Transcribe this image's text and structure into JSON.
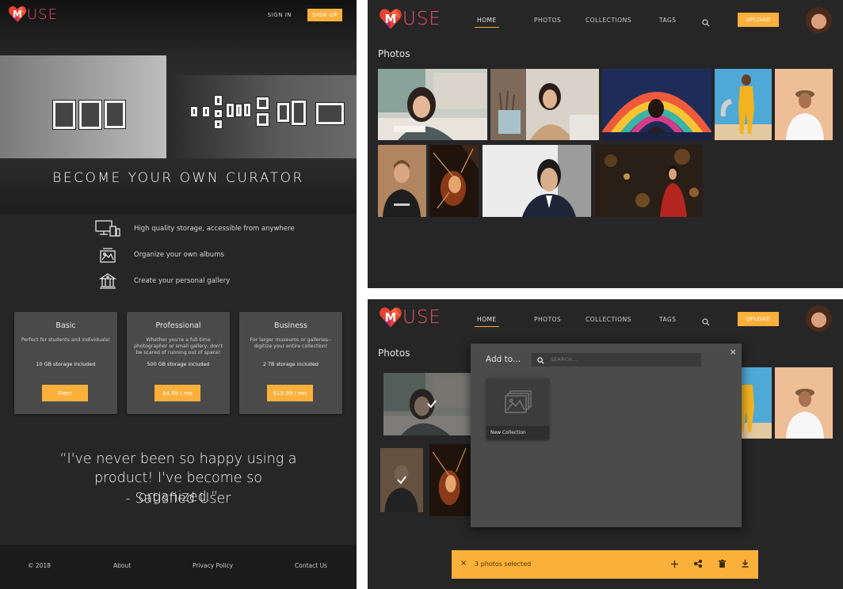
{
  "brand": {
    "logo_letter": "M",
    "logo_rest": "USE"
  },
  "landing": {
    "nav": {
      "sign_in": "SIGN IN",
      "sign_up": "SIGN UP"
    },
    "hero_title": "BECOME YOUR OWN CURATOR",
    "features": [
      {
        "icon": "devices-icon",
        "text": "High quality storage, accessible from anywhere"
      },
      {
        "icon": "album-icon",
        "text": "Organize your own albums"
      },
      {
        "icon": "gallery-building-icon",
        "text": "Create your personal gallery"
      }
    ],
    "plans": [
      {
        "name": "Basic",
        "description": "Perfect for students and individuals!",
        "storage": "10 GB storage included",
        "cta": "Free!"
      },
      {
        "name": "Professional",
        "description": "Whether you're a full-time photographer or small gallery, don't be scared of running out of space!",
        "storage": "500 GB storage included",
        "cta": "$4.99 / mo"
      },
      {
        "name": "Business",
        "description": "For larger museums or galleries--digitize your entire collection!",
        "storage": "2 TB storage included",
        "cta": "$15.99 / mo"
      }
    ],
    "quote": "“I've never been so happy using a product! I've become so organized.”",
    "quote_author": "- Satisfied User",
    "footer": {
      "copyright": "© 2018",
      "about": "About",
      "privacy": "Privacy Policy",
      "contact": "Contact Us"
    }
  },
  "app": {
    "nav": {
      "home": "HOME",
      "photos": "PHOTOS",
      "collections": "COLLECTIONS",
      "tags": "TAGS",
      "upload": "UPLOAD"
    },
    "section_title": "Photos"
  },
  "add_to_modal": {
    "title": "Add to...",
    "search_placeholder": "SEARCH...",
    "new_collection_label": "New Collection",
    "close": "×"
  },
  "selection_bar": {
    "close": "×",
    "text": "3 photos selected",
    "actions": [
      "add-icon",
      "share-icon",
      "trash-icon",
      "download-icon"
    ]
  },
  "colors": {
    "accent": "#fbb03b",
    "brand": "#f0506e",
    "background": "#262626",
    "card": "#4a4a4a"
  }
}
